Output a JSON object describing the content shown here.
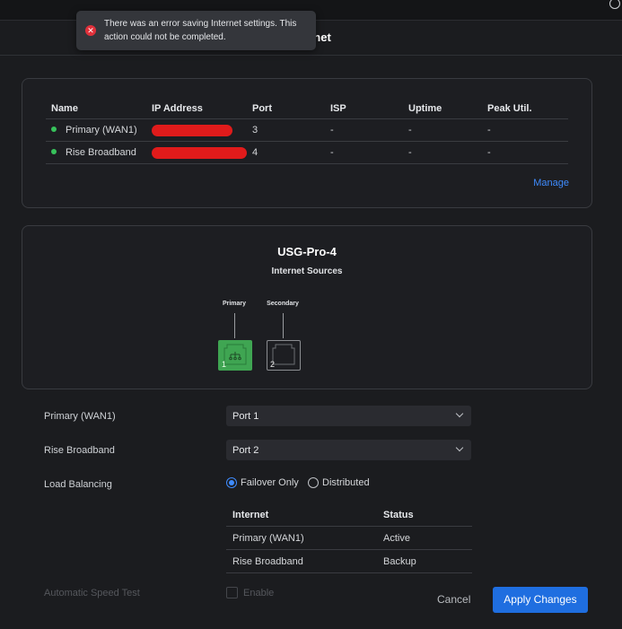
{
  "header": {
    "title": "rnet"
  },
  "toast": {
    "message": "There was an error saving Internet settings. This action could not be completed."
  },
  "wan_table": {
    "columns": [
      "Name",
      "IP Address",
      "Port",
      "ISP",
      "Uptime",
      "Peak Util."
    ],
    "rows": [
      {
        "name": "Primary (WAN1)",
        "port": "3",
        "isp": "-",
        "uptime": "-",
        "peak": "-"
      },
      {
        "name": "Rise Broadband",
        "port": "4",
        "isp": "-",
        "uptime": "-",
        "peak": "-"
      }
    ],
    "manage_label": "Manage"
  },
  "device": {
    "title": "USG-Pro-4",
    "subtitle": "Internet Sources",
    "ports": [
      {
        "label": "Primary",
        "number": "1",
        "active": true
      },
      {
        "label": "Secondary",
        "number": "2",
        "active": false
      }
    ]
  },
  "form": {
    "primary_label": "Primary (WAN1)",
    "primary_value": "Port 1",
    "rise_label": "Rise Broadband",
    "rise_value": "Port 2",
    "lb_label": "Load Balancing",
    "lb_options": [
      "Failover Only",
      "Distributed"
    ],
    "lb_selected": "Failover Only",
    "status_table": {
      "columns": [
        "Internet",
        "Status"
      ],
      "rows": [
        {
          "internet": "Primary (WAN1)",
          "status": "Active"
        },
        {
          "internet": "Rise Broadband",
          "status": "Backup"
        }
      ]
    },
    "speed_label": "Automatic Speed Test",
    "enable_label": "Enable"
  },
  "footer": {
    "cancel": "Cancel",
    "apply": "Apply Changes"
  },
  "colors": {
    "accent": "#1f6ee0",
    "link": "#3f8cff",
    "online": "#37c25b",
    "error": "#e0303a",
    "port_active": "#3fa552"
  }
}
